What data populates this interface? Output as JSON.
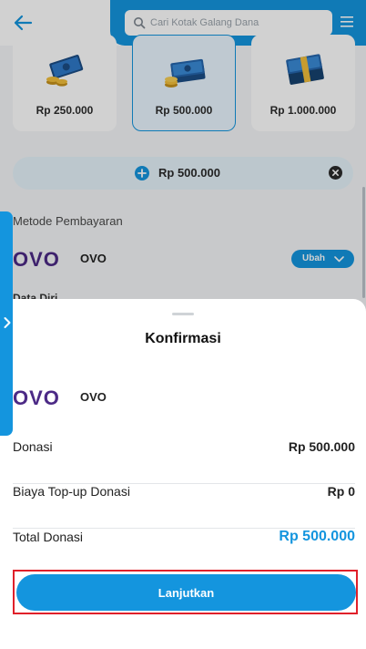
{
  "search": {
    "placeholder": "Cari Kotak Galang Dana"
  },
  "amount_options": [
    {
      "label": "Rp 250.000",
      "selected": false,
      "icon": "money-bills-coins-icon"
    },
    {
      "label": "Rp 500.000",
      "selected": true,
      "icon": "money-stack-coins-icon"
    },
    {
      "label": "Rp 1.000.000",
      "selected": false,
      "icon": "money-bundle-icon"
    }
  ],
  "custom_amount": {
    "value": "Rp 500.000"
  },
  "payment_method": {
    "section_title": "Metode Pembayaran",
    "logo_text": "OVO",
    "name": "OVO",
    "change_label": "Ubah"
  },
  "obscured_label": "Data Diri",
  "sheet": {
    "title": "Konfirmasi",
    "method_logo_text": "OVO",
    "method_name": "OVO",
    "rows": [
      {
        "label": "Donasi",
        "value": "Rp 500.000"
      },
      {
        "label": "Biaya Top-up Donasi",
        "value": "Rp 0"
      },
      {
        "label": "Total Donasi",
        "value": "Rp 500.000"
      }
    ],
    "cta_label": "Lanjutkan"
  },
  "colors": {
    "primary": "#1495de",
    "ovo": "#4c2a86",
    "highlight": "#e0202a"
  }
}
